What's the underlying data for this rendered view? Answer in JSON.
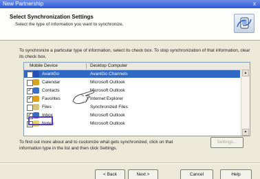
{
  "window": {
    "title": "New Partnership",
    "close_label": "x"
  },
  "header": {
    "title": "Select Synchronization Settings",
    "subtitle": "Select the type of information you want to synchronize."
  },
  "instructions": "To synchronize a particular type of information, select its check box. To stop synchronization of that information, clear its check box.",
  "list": {
    "col_device": "Mobile Device",
    "col_desktop": "Desktop Computer",
    "rows": [
      {
        "device": "AvantGo",
        "app": "AvantGo Channels",
        "checked": false,
        "selected": true,
        "icon": "avantgo-icon",
        "color": "#2a4fb8"
      },
      {
        "device": "Calendar",
        "app": "Microsoft Outlook",
        "checked": false,
        "selected": false,
        "icon": "calendar-icon",
        "color": "#d6a520"
      },
      {
        "device": "Contacts",
        "app": "Microsoft Outlook",
        "checked": true,
        "selected": false,
        "icon": "contacts-icon",
        "color": "#3c6fc7"
      },
      {
        "device": "Favorites",
        "app": "Internet Explorer",
        "checked": true,
        "selected": false,
        "icon": "favorites-icon",
        "color": "#e0a020"
      },
      {
        "device": "Files",
        "app": "Synchronized Files",
        "checked": false,
        "selected": false,
        "icon": "files-icon",
        "color": "#d9c27a"
      },
      {
        "device": "Inbox",
        "app": "Microsoft Outlook",
        "checked": true,
        "selected": false,
        "icon": "inbox-icon",
        "color": "#3a6cc0"
      },
      {
        "device": "Notes",
        "app": "Microsoft Outlook",
        "checked": false,
        "selected": false,
        "icon": "notes-icon",
        "color": "#e8d560"
      }
    ]
  },
  "footer_text": "To find out more about and to customize what gets synchronized, click on that information type in the list and then click Settings.",
  "buttons": {
    "settings": "Settings...",
    "back": "< Back",
    "next": "Next >",
    "cancel": "Cancel",
    "help": "Help"
  }
}
